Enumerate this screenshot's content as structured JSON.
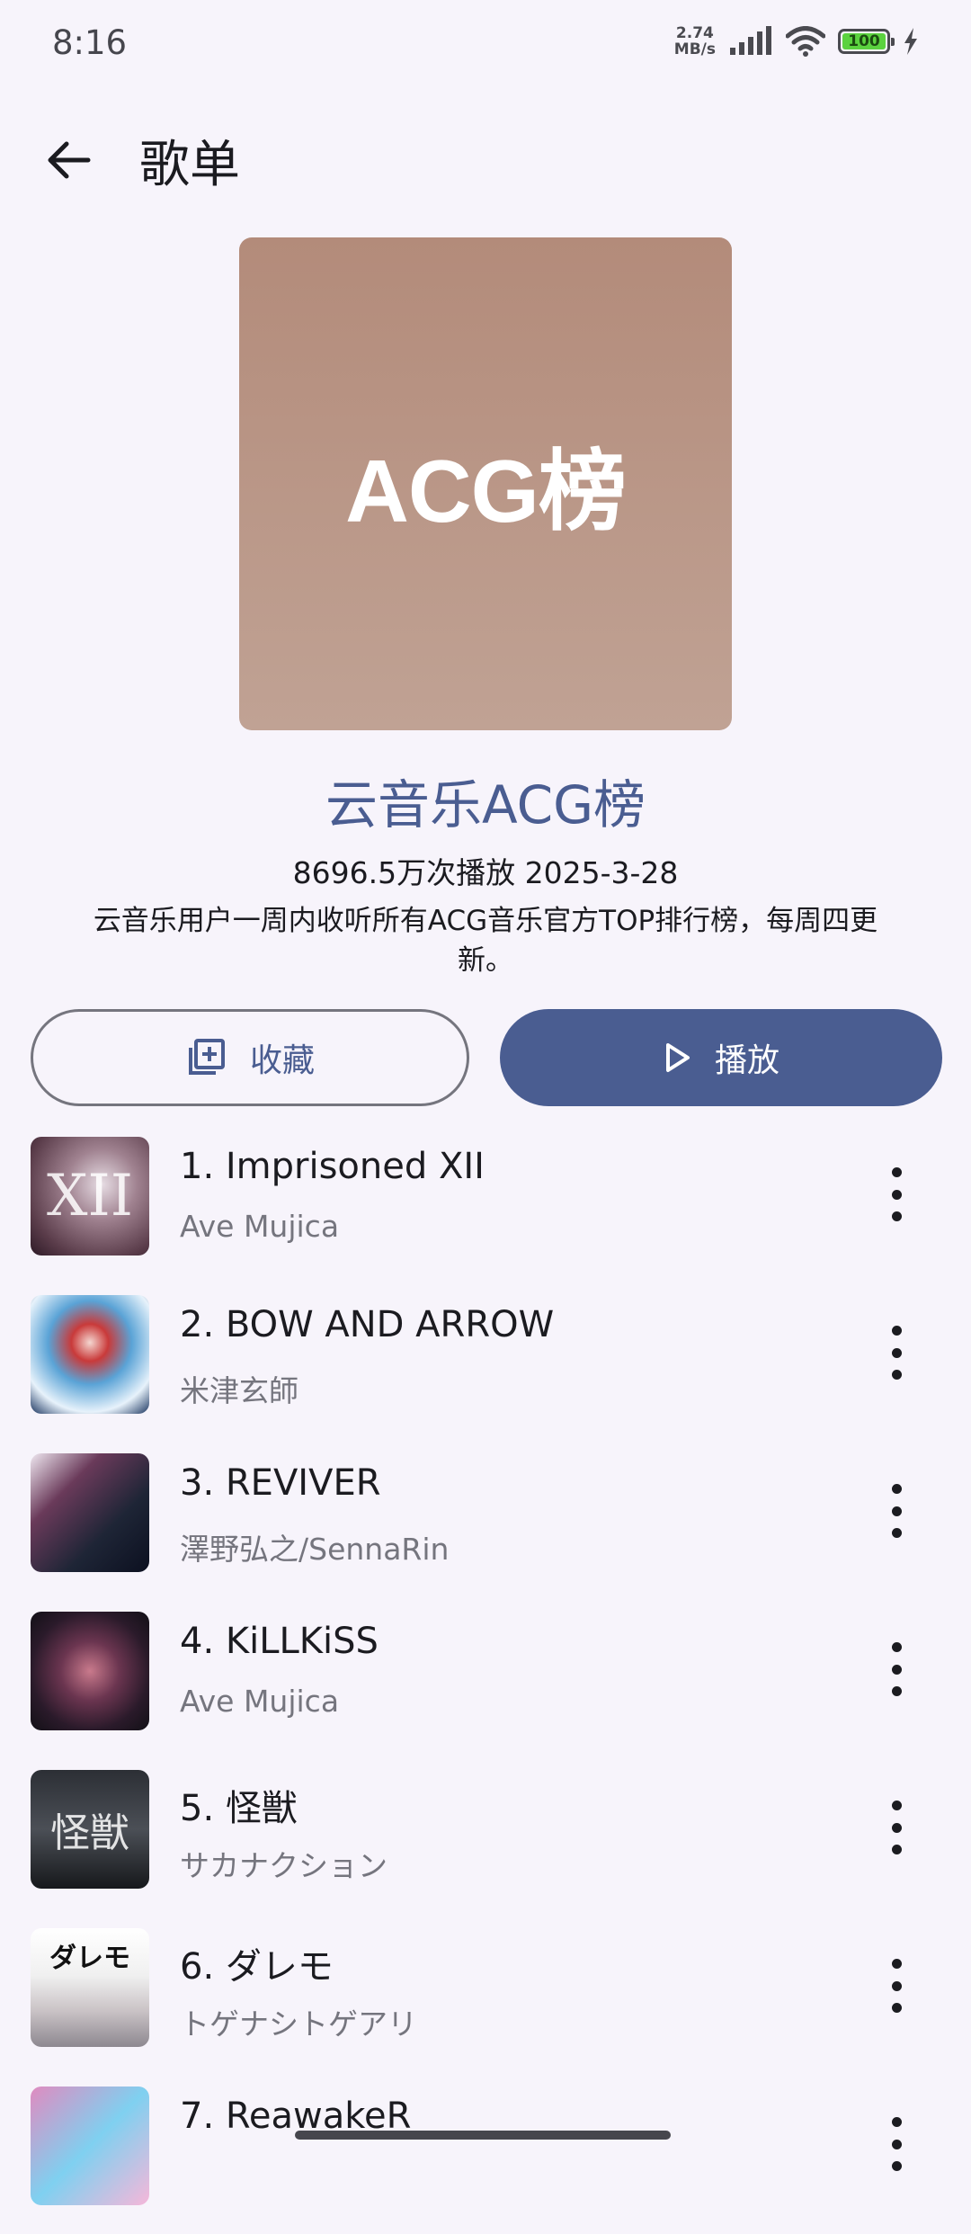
{
  "status_bar": {
    "time": "8:16",
    "net_speed_value": "2.74",
    "net_speed_unit": "MB/s",
    "battery": "100",
    "icons": [
      "signal-icon",
      "wifi-icon",
      "battery-icon",
      "charging-icon"
    ]
  },
  "header": {
    "title": "歌单",
    "back_icon": "arrow-left-icon"
  },
  "playlist": {
    "cover_text": "ACG榜",
    "name": "云音乐ACG榜",
    "meta": "8696.5万次播放 2025-3-28",
    "description": "云音乐用户一周内收听所有ACG音乐官方TOP排行榜，每周四更新。"
  },
  "actions": {
    "favorite_label": "收藏",
    "favorite_icon": "add-to-library-icon",
    "play_label": "播放",
    "play_icon": "play-icon"
  },
  "songs": [
    {
      "title": "1. Imprisoned XII",
      "artist": "Ave Mujica",
      "art_mark": "XII"
    },
    {
      "title": "2. BOW AND ARROW",
      "artist": "米津玄師",
      "art_mark": ""
    },
    {
      "title": "3. REVIVER",
      "artist": "澤野弘之/SennaRin",
      "art_mark": ""
    },
    {
      "title": "4. KiLLKiSS",
      "artist": "Ave Mujica",
      "art_mark": ""
    },
    {
      "title": "5. 怪獣",
      "artist": "サカナクション",
      "art_mark": "怪獣"
    },
    {
      "title": "6. ダレモ",
      "artist": "トゲナシトゲアリ",
      "art_mark": "ダレモ"
    },
    {
      "title": "7. ReawakeR",
      "artist": "",
      "art_mark": ""
    }
  ],
  "colors": {
    "primary": "#4a5d91",
    "background": "#f7f4fb",
    "cover": "#b38b7a",
    "secondary_text": "#75757e"
  }
}
